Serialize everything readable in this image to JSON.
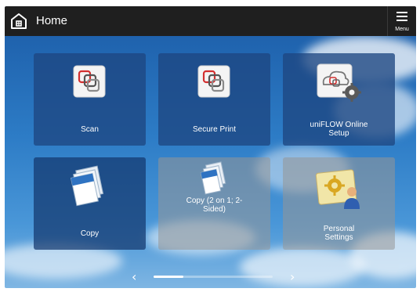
{
  "topbar": {
    "title": "Home",
    "home_icon": "home-icon",
    "menu_label": "Menu",
    "menu_icon": "hamburger-icon"
  },
  "tiles": [
    {
      "label": "Scan",
      "icon": "scan-icon"
    },
    {
      "label": "Secure Print",
      "icon": "secure-print-icon"
    },
    {
      "label": "uniFLOW Online Setup",
      "icon": "cloud-settings-icon"
    },
    {
      "label": "Copy",
      "icon": "copy-icon"
    },
    {
      "label": "Copy (2 on 1; 2-Sided)",
      "icon": "copy-2on1-icon"
    },
    {
      "label": "Personal Settings",
      "icon": "personal-settings-icon"
    }
  ],
  "footer": {
    "prev_icon": "chevron-left-icon",
    "next_icon": "chevron-right-icon",
    "page_position": 0.25
  }
}
